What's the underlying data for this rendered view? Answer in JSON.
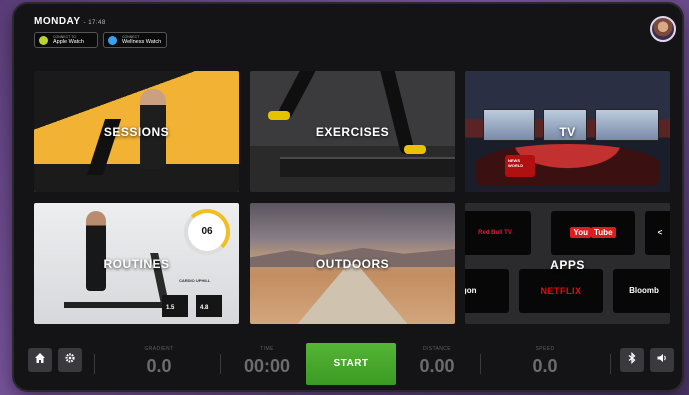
{
  "header": {
    "day": "MONDAY",
    "time": "- 17:48",
    "badges": [
      {
        "small": "CONNECT TO",
        "label": "Apple Watch",
        "color": "#b8d432"
      },
      {
        "small": "CONNECT",
        "label": "Wellness Watch",
        "color": "#3aa0f0"
      }
    ]
  },
  "tiles": {
    "sessions": "SESSIONS",
    "exercises": "EXERCISES",
    "tv": "TV",
    "routines": "ROUTINES",
    "outdoors": "OUTDOORS",
    "apps": "APPS"
  },
  "routines_detail": {
    "ring_value": "06",
    "caption": "CARDIO UPHILL",
    "mini1": "1.5",
    "mini2": "4.8"
  },
  "tv_detail": {
    "logo": "NEWS WORLD"
  },
  "apps_detail": {
    "redbull": "Red Bull TV",
    "youtube_you": "You",
    "youtube_tube": "Tube",
    "netflix": "NETFLIX",
    "bloomberg": "Bloomb",
    "partial_left": "ygon",
    "partial_right": "<"
  },
  "bottom_bar": {
    "metrics": [
      {
        "key": "GRADIENT",
        "value": "0.0"
      },
      {
        "key": "TIME",
        "value": "00:00"
      },
      {
        "key": "DISTANCE",
        "value": "0.00"
      },
      {
        "key": "SPEED",
        "value": "0.0"
      }
    ],
    "start_label": "START",
    "icons": {
      "home": "home-icon",
      "settings": "gear-icon",
      "bluetooth": "bluetooth-icon",
      "volume": "volume-icon"
    }
  }
}
